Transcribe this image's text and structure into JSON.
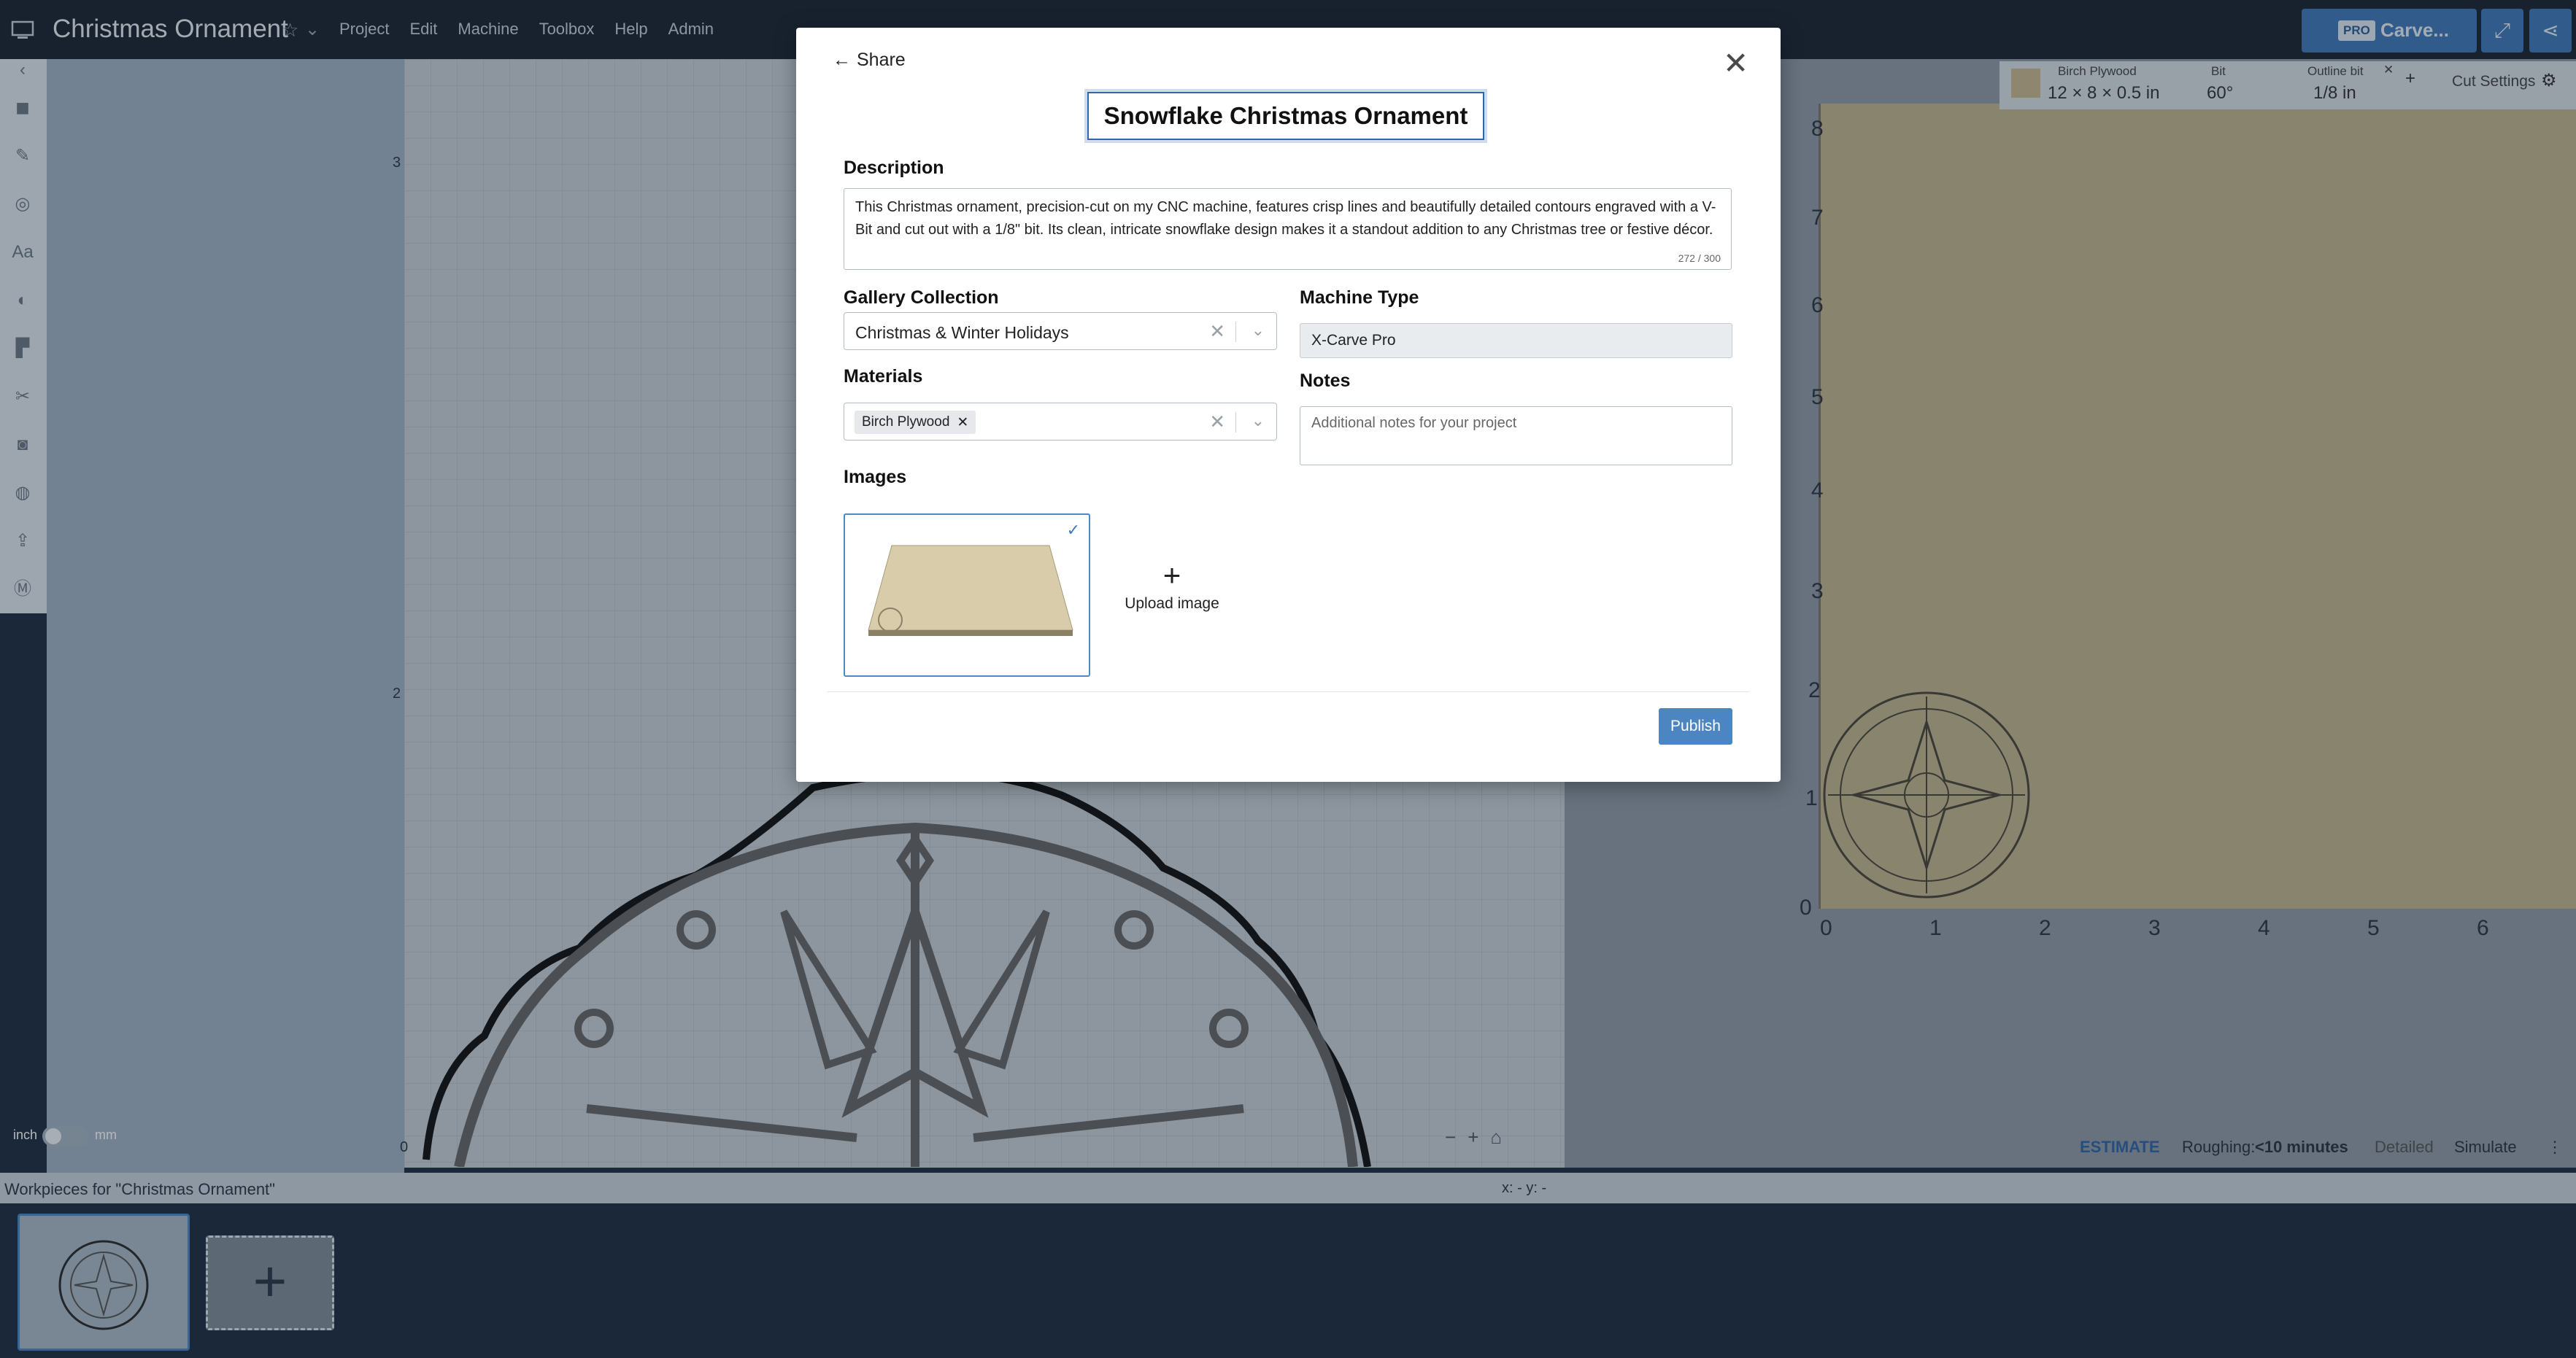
{
  "app": {
    "title": "Christmas Ornament",
    "menu": [
      "Project",
      "Edit",
      "Machine",
      "Toolbox",
      "Help",
      "Admin"
    ],
    "carve_badge": "PRO",
    "carve_label": "Carve..."
  },
  "material_bar": {
    "material_name": "Birch Plywood",
    "material_size": "12 × 8 × 0.5 in",
    "bit_label": "Bit",
    "bit_value": "60°",
    "outline_bit_label": "Outline bit",
    "outline_bit_value": "1/8 in",
    "cut_settings": "Cut Settings"
  },
  "ruler_left": [
    "3",
    "2",
    "0"
  ],
  "ruler_right_y": [
    "8",
    "7",
    "6",
    "5",
    "4",
    "3",
    "2",
    "1",
    "0"
  ],
  "ruler_right_x": [
    "0",
    "1",
    "2",
    "3",
    "4",
    "5",
    "6"
  ],
  "units": {
    "inch": "inch",
    "mm": "mm"
  },
  "estimate": {
    "label": "ESTIMATE",
    "roughing_label": "Roughing:",
    "roughing_value": "<10 minutes",
    "detailed": "Detailed",
    "simulate": "Simulate"
  },
  "workpieces": {
    "header": "Workpieces for \"Christmas Ornament\"",
    "coords": "x: - y: -"
  },
  "modal": {
    "back_label": "Share",
    "project_title": "Snowflake Christmas Ornament",
    "description_label": "Description",
    "description_text": "This Christmas ornament, precision-cut on my CNC machine, features crisp lines and beautifully detailed contours engraved with a V-Bit and cut out with a 1/8\" bit.  Its clean, intricate snowflake design makes it a standout addition to any Christmas tree or festive décor.",
    "description_count": "272 / 300",
    "gallery_label": "Gallery Collection",
    "gallery_value": "Christmas & Winter Holidays",
    "materials_label": "Materials",
    "material_chip": "Birch Plywood",
    "machine_label": "Machine Type",
    "machine_value": "X-Carve Pro",
    "notes_label": "Notes",
    "notes_placeholder": "Additional notes for your project",
    "images_label": "Images",
    "upload_label": "Upload image",
    "publish_label": "Publish"
  },
  "colors": {
    "primary": "#4b86c3",
    "topbar": "#1b2432",
    "board": "#c2b48e"
  }
}
